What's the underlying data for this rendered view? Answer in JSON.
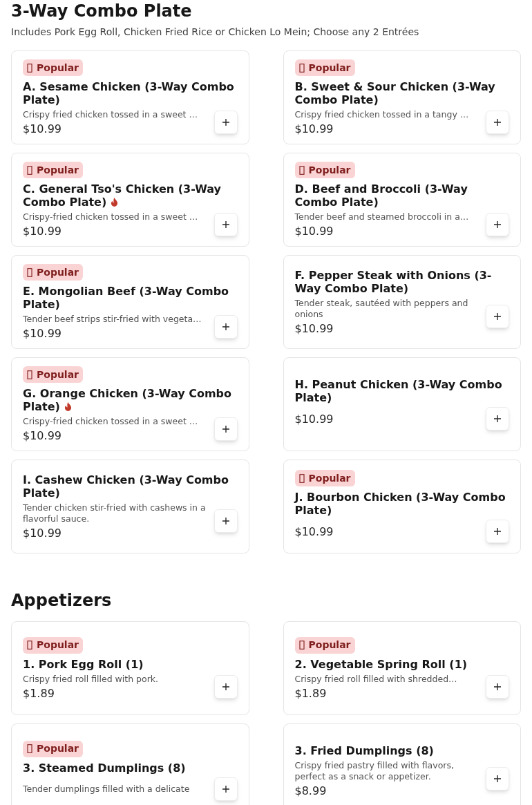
{
  "sections": [
    {
      "title": "3-Way Combo Plate",
      "subtitle": "Includes Pork Egg Roll, Chicken Fried Rice or Chicken Lo Mein; Choose any 2 Entrées",
      "items": [
        {
          "name": "A. Sesame Chicken (3-Way Combo Plate)",
          "description": "Crispy fried chicken tossed in a sweet …",
          "price": "$10.99",
          "badge": "Popular",
          "spicy": false
        },
        {
          "name": "B. Sweet & Sour Chicken (3-Way Combo Plate)",
          "description": "Crispy fried chicken tossed in a tangy …",
          "price": "$10.99",
          "badge": "Popular",
          "spicy": false
        },
        {
          "name": "C. General Tso's Chicken (3-Way Combo Plate)",
          "description": "Crispy-fried chicken tossed in a sweet …",
          "price": "$10.99",
          "badge": "Popular",
          "spicy": true
        },
        {
          "name": "D. Beef and Broccoli (3-Way Combo Plate)",
          "description": "Tender beef and steamed broccoli in a…",
          "price": "$10.99",
          "badge": "Popular",
          "spicy": false
        },
        {
          "name": "E. Mongolian Beef (3-Way Combo Plate)",
          "description": "Tender beef strips stir-fried with vegeta…",
          "price": "$10.99",
          "badge": "Popular",
          "spicy": false
        },
        {
          "name": "F. Pepper Steak with Onions (3-Way Combo Plate)",
          "description": "Tender steak, sautéed with peppers and onions",
          "price": "$10.99",
          "spicy": false
        },
        {
          "name": "G. Orange Chicken (3-Way Combo Plate)",
          "description": "Crispy-fried chicken tossed in a sweet …",
          "price": "$10.99",
          "badge": "Popular",
          "spicy": true
        },
        {
          "name": "H. Peanut Chicken (3-Way Combo Plate)",
          "price": "$10.99",
          "spicy": false
        },
        {
          "name": "I. Cashew Chicken (3-Way Combo Plate)",
          "description": "Tender chicken stir-fried with cashews in a flavorful sauce.",
          "price": "$10.99",
          "spicy": false
        },
        {
          "name": "J. Bourbon Chicken (3-Way Combo Plate)",
          "price": "$10.99",
          "badge": "Popular",
          "spicy": false
        }
      ]
    },
    {
      "title": "Appetizers",
      "items": [
        {
          "name": "1. Pork Egg Roll (1)",
          "description": "Crispy fried roll filled with pork.",
          "price": "$1.89",
          "badge": "Popular",
          "spicy": false
        },
        {
          "name": "2. Vegetable Spring Roll (1)",
          "description": "Crispy fried roll filled with shredded…",
          "price": "$1.89",
          "badge": "Popular",
          "spicy": false
        },
        {
          "name": "3. Steamed Dumplings (8)",
          "description": "Tender dumplings filled with a delicate",
          "badge": "Popular",
          "spicy": false
        },
        {
          "name": "3. Fried Dumplings (8)",
          "description": "Crispy fried pastry filled with flavors, perfect as a snack or appetizer.",
          "price": "$8.99",
          "spicy": false
        }
      ]
    }
  ]
}
